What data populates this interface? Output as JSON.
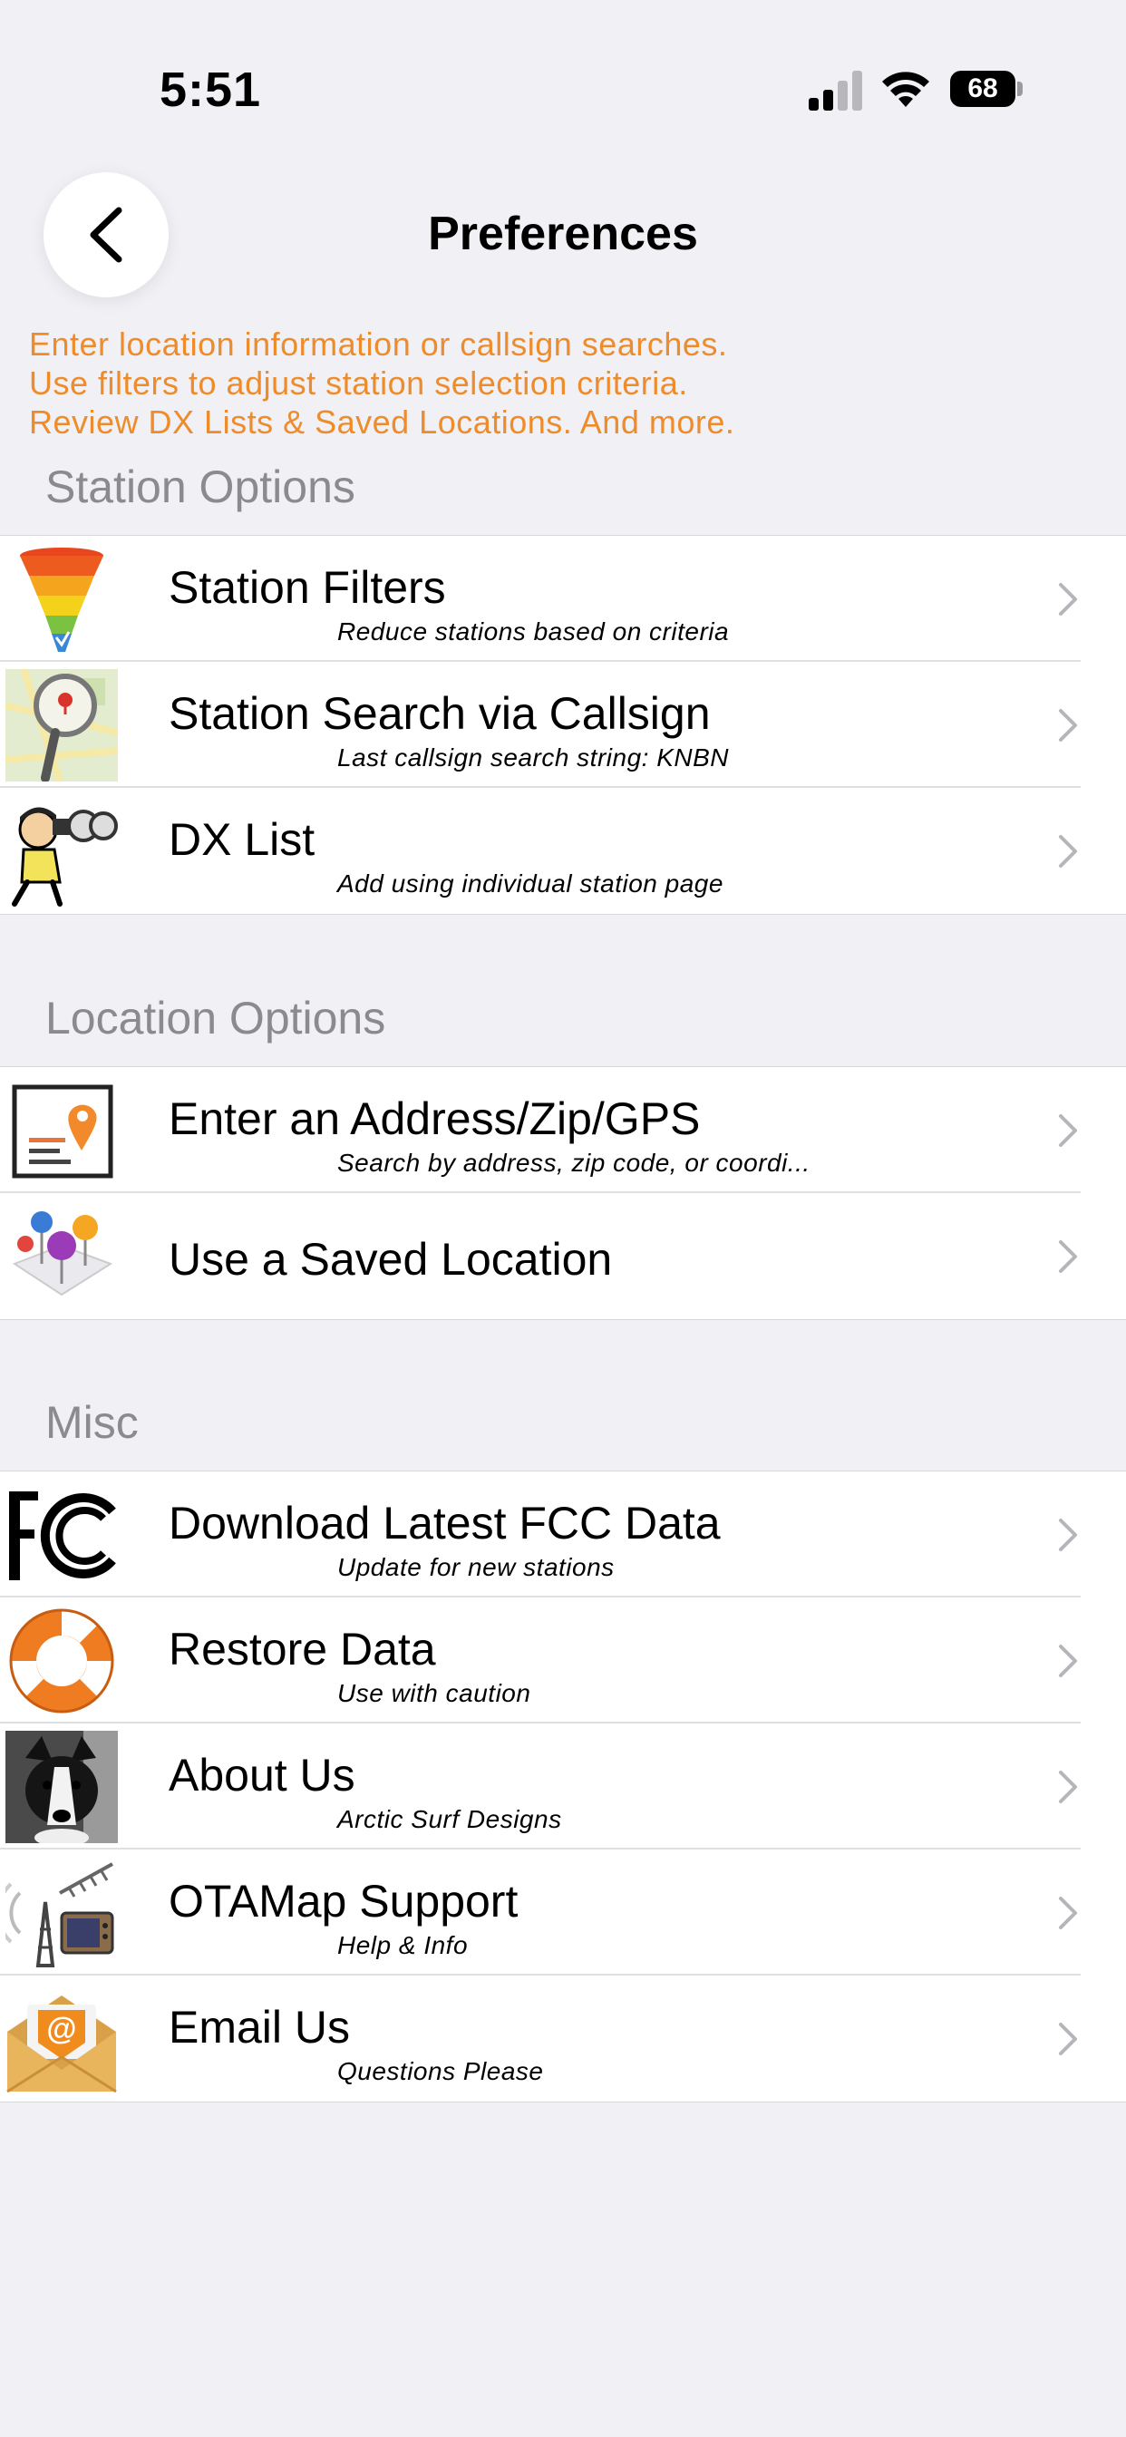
{
  "status": {
    "time": "5:51",
    "battery": "68"
  },
  "header": {
    "title": "Preferences"
  },
  "intro": [
    "Enter location information or callsign searches.",
    "Use filters to adjust station selection criteria.",
    "Review DX Lists & Saved Locations. And more."
  ],
  "sections": {
    "station": {
      "label": "Station Options",
      "items": [
        {
          "label": "Station Filters",
          "sub": "Reduce stations based on criteria",
          "icon": "funnel-icon"
        },
        {
          "label": "Station Search via Callsign",
          "sub": "Last callsign search string: KNBN",
          "icon": "map-magnifier-icon"
        },
        {
          "label": "DX List",
          "sub": "Add using individual station page",
          "icon": "binoculars-man-icon"
        }
      ]
    },
    "location": {
      "label": "Location Options",
      "items": [
        {
          "label": "Enter an Address/Zip/GPS",
          "sub": "Search by address, zip code, or coordi...",
          "icon": "address-pin-icon"
        },
        {
          "label": "Use a Saved Location",
          "sub": "",
          "icon": "saved-pins-icon"
        }
      ]
    },
    "misc": {
      "label": "Misc",
      "items": [
        {
          "label": "Download Latest FCC Data",
          "sub": "Update for new stations",
          "icon": "fcc-logo-icon"
        },
        {
          "label": "Restore Data",
          "sub": "Use with caution",
          "icon": "lifebuoy-icon"
        },
        {
          "label": "About Us",
          "sub": "Arctic Surf Designs",
          "icon": "dog-photo-icon"
        },
        {
          "label": "OTAMap Support",
          "sub": "Help & Info",
          "icon": "antenna-tv-icon"
        },
        {
          "label": "Email Us",
          "sub": "Questions Please",
          "icon": "envelope-icon"
        }
      ]
    }
  },
  "colors": {
    "accent": "#ee8c2c",
    "background": "#f0f0f5",
    "section_label": "#8a8a8f"
  }
}
